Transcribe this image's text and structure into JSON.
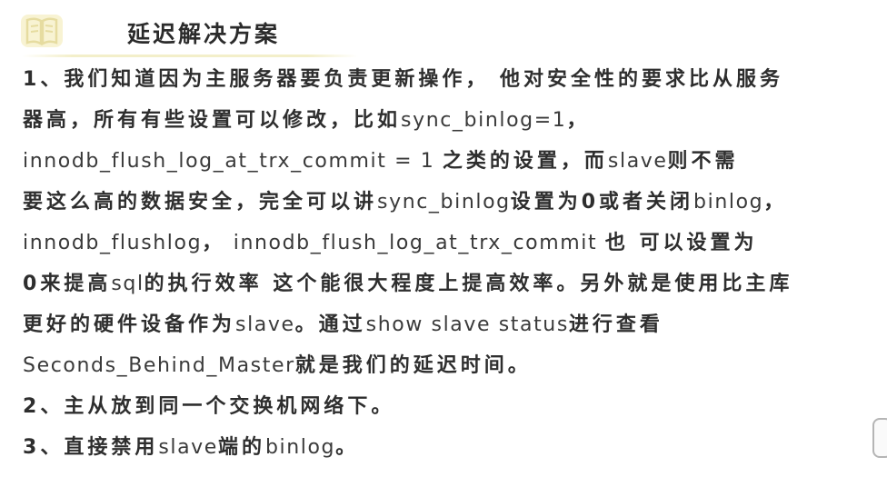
{
  "title": "延迟解决方案",
  "lines": [
    "1、我们知道因为主服务器要负责更新操作， 他对安全性的要求比从服务",
    "器高，所有有些设置可以修改，比如sync_binlog=1，",
    "innodb_flush_log_at_trx_commit = 1 之类的设置，而slave则不需",
    "要这么高的数据安全，完全可以讲sync_binlog设置为0或者关闭binlog，",
    "innodb_flushlog， innodb_flush_log_at_trx_commit 也 可以设置为",
    "0来提高sql的执行效率 这个能很大程度上提高效率。另外就是使用比主库",
    "更好的硬件设备作为slave。通过show slave status进行查看",
    "Seconds_Behind_Master就是我们的延迟时间。",
    "2、主从放到同一个交换机网络下。",
    "3、直接禁用slave端的binlog。"
  ],
  "icons": {
    "title_icon": "book-icon"
  }
}
